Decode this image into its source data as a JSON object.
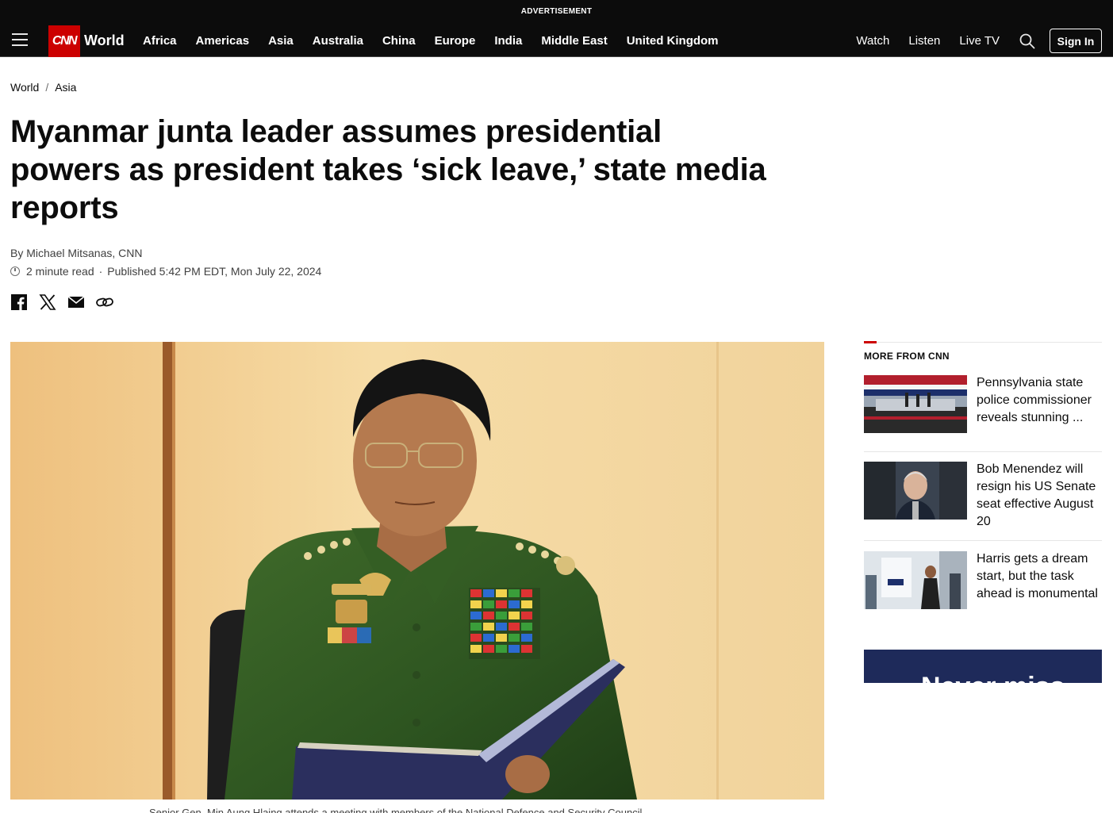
{
  "header": {
    "ad_label": "ADVERTISEMENT",
    "logo_text": "CNN",
    "section": "World",
    "nav": [
      "Africa",
      "Americas",
      "Asia",
      "Australia",
      "China",
      "Europe",
      "India",
      "Middle East",
      "United Kingdom"
    ],
    "nav_right": [
      "Watch",
      "Listen",
      "Live TV"
    ],
    "signin_label": "Sign In",
    "brand_color": "#cc0000"
  },
  "breadcrumb": [
    "World",
    "Asia"
  ],
  "article": {
    "headline": "Myanmar junta leader assumes presidential powers as president takes ‘sick leave,’ state media reports",
    "byline": "By Michael Mitsanas, CNN",
    "read_time": "2 minute read",
    "published": "Published 5:42 PM EDT, Mon July 22, 2024",
    "share_icons": [
      "facebook-icon",
      "x-icon",
      "email-icon",
      "link-icon"
    ],
    "caption": "Senior Gen. Min Aung Hlaing attends a meeting with members of the National Defence and Security Council"
  },
  "sidebar": {
    "title": "MORE FROM CNN",
    "items": [
      {
        "title": "Pennsylvania state police commissioner reveals stunning ..."
      },
      {
        "title": "Bob Menendez will resign his US Senate seat effective August 20"
      },
      {
        "title": "Harris gets a dream start, but the task ahead is monumental"
      }
    ],
    "promo_text": "Never miss"
  }
}
